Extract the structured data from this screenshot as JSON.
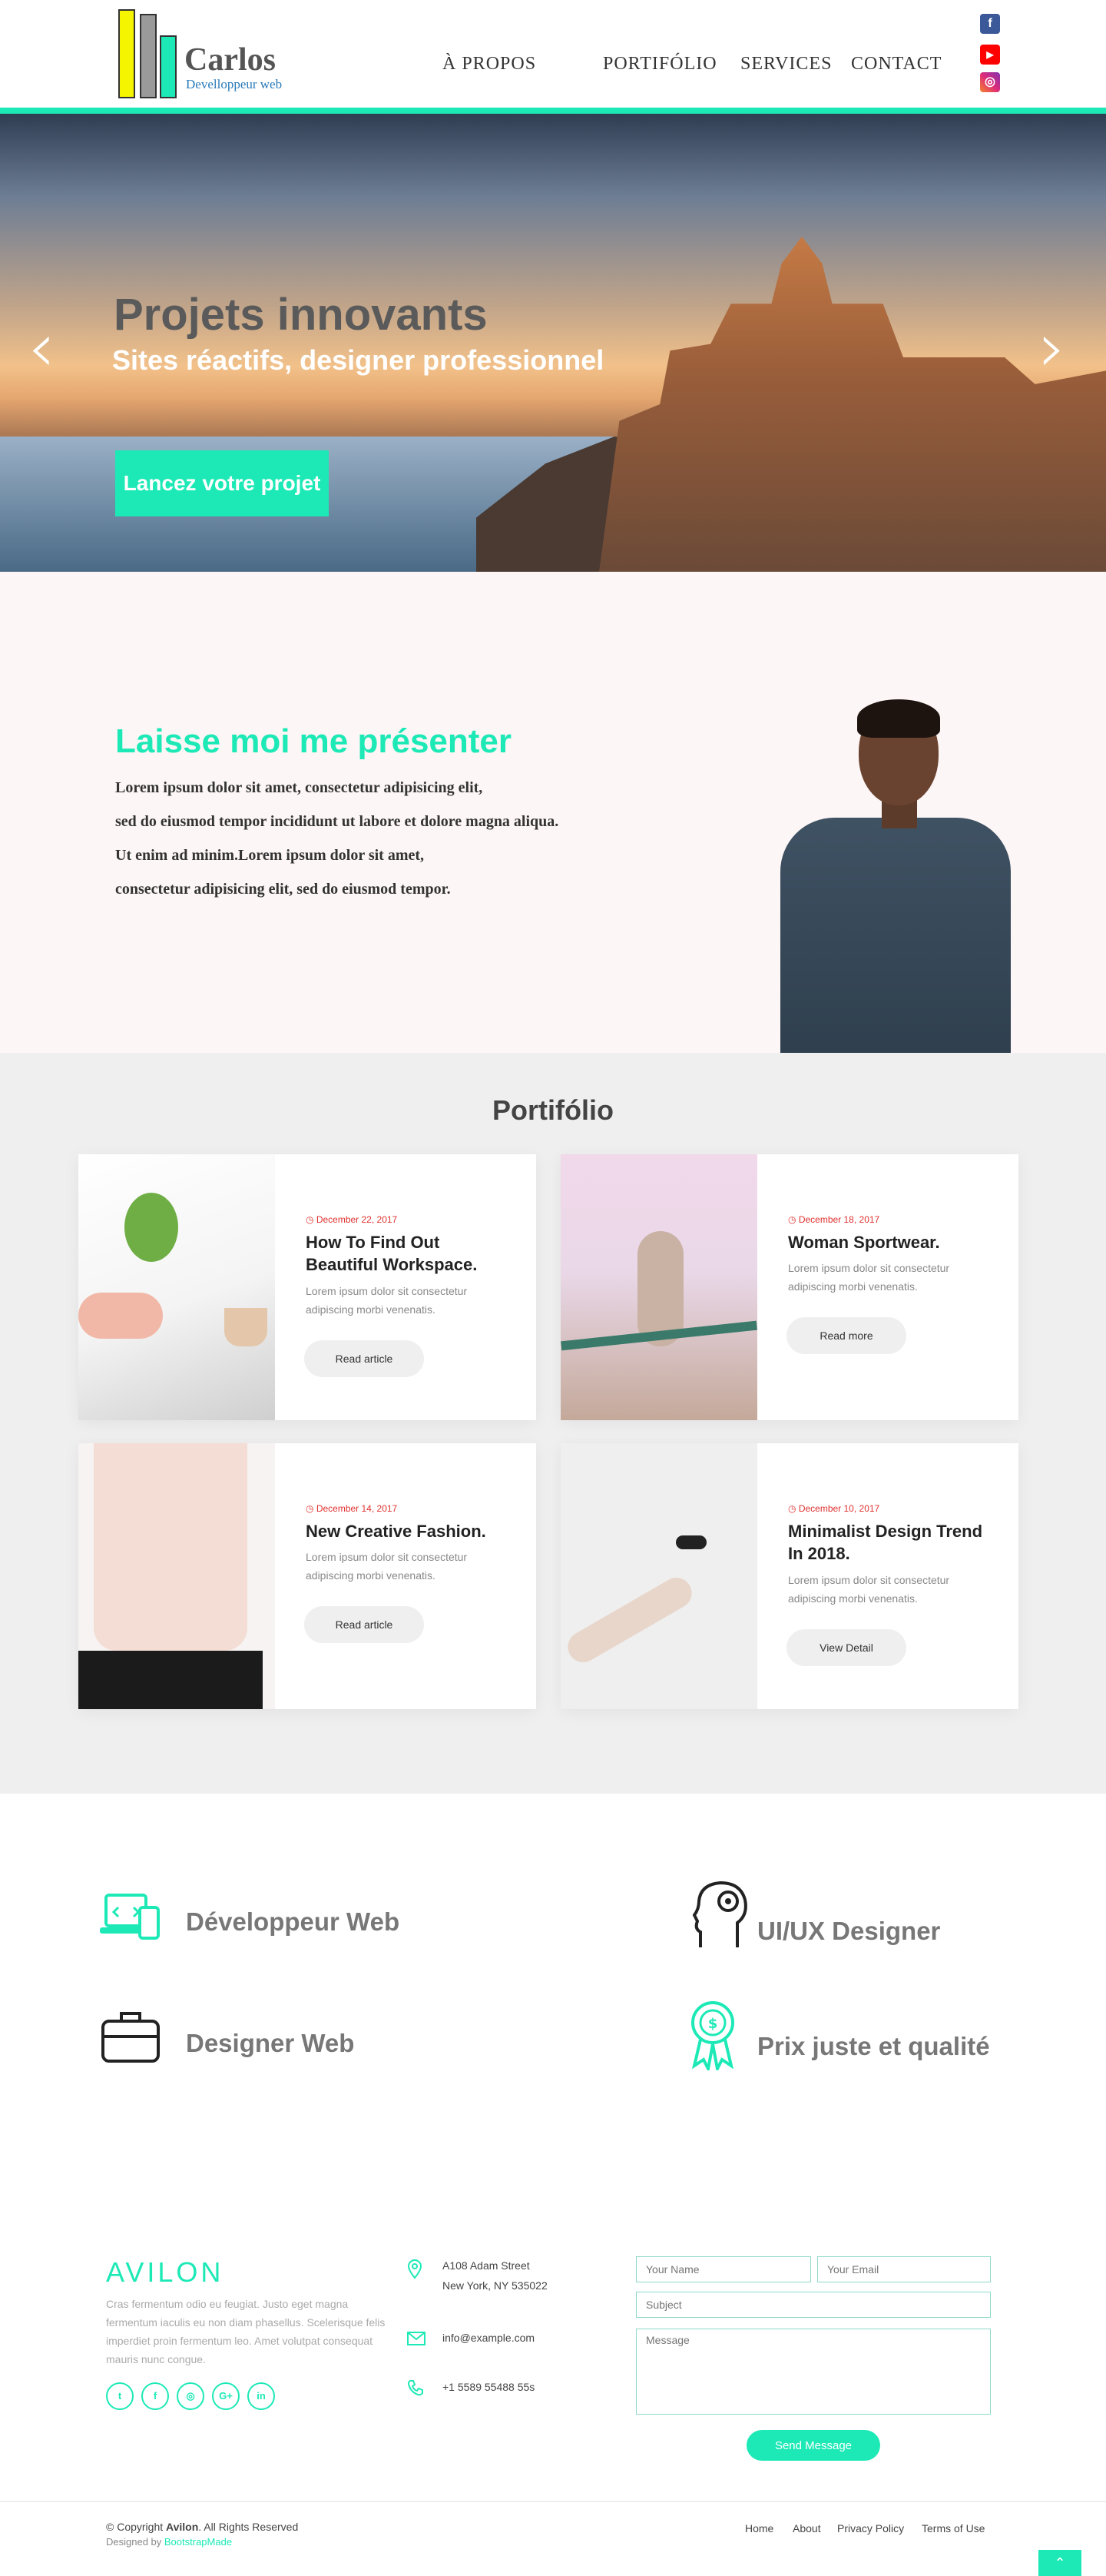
{
  "header": {
    "logo_name": "Carlos",
    "logo_subtitle": "Develloppeur web",
    "nav": [
      "À PROPOS",
      "PORTIFÓLIO",
      "SERVICES",
      "CONTACT"
    ],
    "social": [
      {
        "icon": "facebook-icon",
        "glyph": "f",
        "color": "#3b5998"
      },
      {
        "icon": "youtube-icon",
        "glyph": "▶",
        "color": "#ff0000"
      },
      {
        "icon": "instagram-icon",
        "glyph": "◎",
        "color": "#e1306c"
      }
    ],
    "accent": "#1de9b6"
  },
  "hero": {
    "title": "Projets innovants",
    "subtitle": "Sites réactifs, designer professionnel",
    "cta": "Lancez votre projet",
    "prev_glyph": "‹",
    "next_glyph": "›"
  },
  "about": {
    "title": "Laisse moi me présenter",
    "lines": [
      "Lorem ipsum dolor sit amet, consectetur adipisicing elit,",
      "sed do eiusmod tempor incididunt ut labore et dolore magna aliqua.",
      "Ut enim ad minim.Lorem ipsum dolor sit amet,",
      "consectetur adipisicing elit, sed do eiusmod tempor."
    ]
  },
  "portfolio": {
    "title": "Portifólio",
    "cards": [
      {
        "date": "December 22, 2017",
        "title": "How To Find Out Beautiful Workspace.",
        "desc": "Lorem ipsum dolor sit consectetur adipiscing morbi venenatis.",
        "button": "Read article"
      },
      {
        "date": "December 18, 2017",
        "title": "Woman Sportwear.",
        "desc": "Lorem ipsum dolor sit consectetur adipiscing morbi venenatis.",
        "button": "Read more"
      },
      {
        "date": "December 14, 2017",
        "title": "New Creative Fashion.",
        "desc": "Lorem ipsum dolor sit consectetur adipiscing morbi venenatis.",
        "button": "Read article"
      },
      {
        "date": "December 10, 2017",
        "title": "Minimalist Design Trend In 2018.",
        "desc": "Lorem ipsum dolor sit consectetur adipiscing morbi venenatis.",
        "button": "View Detail"
      }
    ]
  },
  "services": {
    "items": [
      "Développeur Web",
      "UI/UX Designer",
      "Designer Web",
      "Prix juste  et qualité"
    ]
  },
  "footer": {
    "brand": "AVILON",
    "text": "Cras fermentum odio eu feugiat. Justo eget magna fermentum iaculis eu non diam phasellus. Scelerisque felis imperdiet proin fermentum leo. Amet volutpat consequat mauris nunc congue.",
    "socials": [
      "t",
      "f",
      "◎",
      "G+",
      "in"
    ],
    "address_line1": "A108 Adam Street",
    "address_line2": "New York, NY 535022",
    "email": "info@example.com",
    "phone": "+1 5589 55488 55s",
    "form": {
      "name_placeholder": "Your Name",
      "email_placeholder": "Your Email",
      "subject_placeholder": "Subject",
      "message_placeholder": "Message",
      "send": "Send Message"
    },
    "copyright_prefix": "© Copyright ",
    "copyright_brand": "Avilon",
    "copyright_suffix": ". All Rights Reserved",
    "designed_by": "Designed by ",
    "designed_link": "BootstrapMade",
    "links": [
      "Home",
      "About",
      "Privacy Policy",
      "Terms of Use"
    ],
    "to_top_glyph": "⌃"
  }
}
